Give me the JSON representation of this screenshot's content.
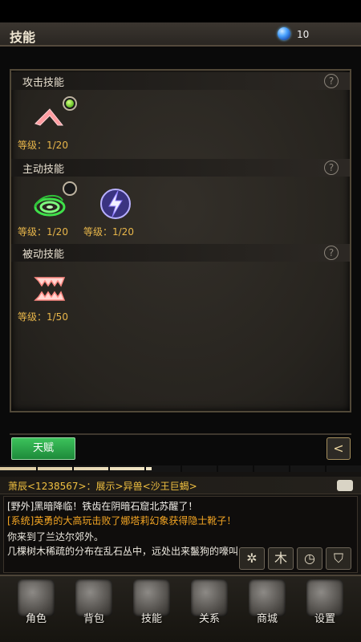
{
  "header": {
    "title": "技能",
    "currency_icon": "blue-gem-icon",
    "currency_count": "10"
  },
  "sections": {
    "attack": {
      "label": "攻击技能",
      "skills": [
        {
          "icon": "fang-slash-icon",
          "level": "等级：1/20"
        }
      ]
    },
    "active": {
      "label": "主动技能",
      "skills": [
        {
          "icon": "green-vortex-icon",
          "level": "等级：1/20"
        },
        {
          "icon": "lightning-orb-icon",
          "level": "等级：1/20"
        }
      ]
    },
    "passive": {
      "label": "被动技能",
      "skills": [
        {
          "icon": "jaws-icon",
          "level": "等级：1/50"
        }
      ]
    }
  },
  "buttons": {
    "talent": "天赋",
    "back": "<"
  },
  "progress": {
    "fraction": 0.42
  },
  "chat": {
    "channel_line": "萧辰<1238567>：展示>异兽<沙王巨蝎>",
    "messages": [
      {
        "type": "wild",
        "text": "[野外]黑暗降临！铁齿在阴暗石窟北苏醒了！"
      },
      {
        "type": "sys",
        "text": "[系统]英勇的大高玩击败了娜塔莉幻象获得隐士靴子！"
      },
      {
        "type": "plain",
        "text": "你来到了兰达尔郊外。"
      },
      {
        "type": "plain",
        "text": "几棵树木稀疏的分布在乱石丛中，远处出来鬣狗的嚎叫"
      }
    ]
  },
  "quick_icons": [
    "gear-wheel-icon",
    "tree-icon",
    "clock-icon",
    "shield-icon"
  ],
  "nav": [
    {
      "label": "角色",
      "icon": "helmet-icon"
    },
    {
      "label": "背包",
      "icon": "armor-icon"
    },
    {
      "label": "技能",
      "icon": "skill-book-icon"
    },
    {
      "label": "关系",
      "icon": "gauntlet-icon"
    },
    {
      "label": "商城",
      "icon": "shop-chest-icon"
    },
    {
      "label": "设置",
      "icon": "settings-gear-icon"
    }
  ]
}
